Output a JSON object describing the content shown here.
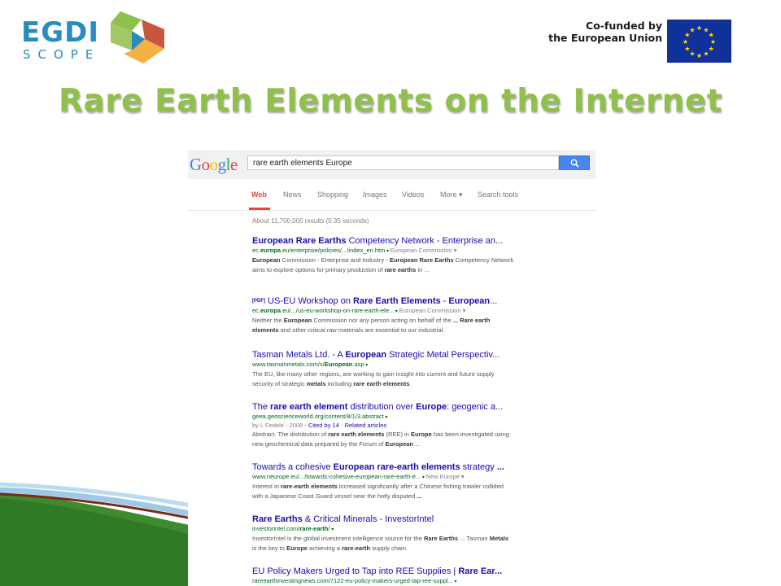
{
  "logo": {
    "name": "EGDI",
    "sub": "SCOPE"
  },
  "eu": {
    "line1": "Co-funded by",
    "line2": "the European Union"
  },
  "slide_title": "Rare Earth Elements on the Internet",
  "google": {
    "logo": "Google",
    "query": "rare earth elements Europe",
    "tabs": [
      "Web",
      "News",
      "Shopping",
      "Images",
      "Videos",
      "More ▾",
      "Search tools"
    ],
    "stats": "About 11,700,000 results (0.35 seconds)",
    "results": [
      {
        "title_parts": [
          [
            "European Rare Earths",
            1
          ],
          [
            " Competency Network - Enterprise an...",
            0
          ]
        ],
        "url_parts": [
          [
            "ec.",
            0
          ],
          [
            "europa",
            1
          ],
          [
            ".eu/enterprise/policies/.../index_en.htm",
            0
          ]
        ],
        "source": "European Commission",
        "desc_parts": [
          [
            "European",
            1
          ],
          [
            " Commission - Enterprise and Industry - ",
            0
          ],
          [
            "European Rare Earths",
            1
          ],
          [
            " Competency Network aims to explore options for primary production of ",
            0
          ],
          [
            "rare earths",
            1
          ],
          [
            " in ...",
            0
          ]
        ]
      },
      {
        "pdf": "[PDF]",
        "title_parts": [
          [
            " US-EU Workshop on ",
            0
          ],
          [
            "Rare Earth Elements",
            1
          ],
          [
            " - ",
            0
          ],
          [
            "European",
            1
          ],
          [
            "...",
            0
          ]
        ],
        "url_parts": [
          [
            "ec.",
            0
          ],
          [
            "europa",
            1
          ],
          [
            ".eu/.../us-eu-workshop-on-rare-earth-ele...",
            0
          ]
        ],
        "source": "European Commission",
        "desc_parts": [
          [
            "Neither the ",
            0
          ],
          [
            "European",
            1
          ],
          [
            " Commission nor any person acting on behalf of the ",
            0
          ],
          [
            "...",
            1
          ],
          [
            " ",
            0
          ],
          [
            "Rare earth elements",
            1
          ],
          [
            " and other critical raw materials are essential to our industrial.",
            0
          ]
        ]
      },
      {
        "title_parts": [
          [
            "Tasman Metals Ltd. - A ",
            0
          ],
          [
            "European",
            1
          ],
          [
            " Strategic Metal Perspectiv...",
            0
          ]
        ],
        "url_parts": [
          [
            "www.tasmanmetals.com/s/",
            0
          ],
          [
            "European",
            1
          ],
          [
            ".asp",
            0
          ]
        ],
        "desc_parts": [
          [
            "The EU, like many other regions, are working to gain insight into current and future supply security of strategic ",
            0
          ],
          [
            "metals",
            1
          ],
          [
            " including ",
            0
          ],
          [
            "rare earth elements",
            1
          ],
          [
            ".",
            0
          ]
        ]
      },
      {
        "title_parts": [
          [
            "The ",
            0
          ],
          [
            "rare earth element",
            1
          ],
          [
            " distribution over ",
            0
          ],
          [
            "Europe",
            1
          ],
          [
            ": geogenic a...",
            0
          ]
        ],
        "url_parts": [
          [
            "geea.geoscienceworld.org/content/8/1/3.abstract",
            0
          ]
        ],
        "meta": {
          "author": "by L Fedele - 2008 - ",
          "cited": "Cited by 14",
          "sep": " - ",
          "related": "Related articles"
        },
        "desc_parts": [
          [
            "Abstract. The distribution of ",
            0
          ],
          [
            "rare earth elements",
            1
          ],
          [
            " (REE) in ",
            0
          ],
          [
            "Europe",
            1
          ],
          [
            " has been investigated using new geochemical data prepared by the Forum of ",
            0
          ],
          [
            "European",
            1
          ],
          [
            " ...",
            0
          ]
        ]
      },
      {
        "title_parts": [
          [
            "Towards a cohesive ",
            0
          ],
          [
            "European rare-earth elements",
            1
          ],
          [
            " strategy ",
            0
          ],
          [
            "...",
            1
          ]
        ],
        "url_parts": [
          [
            "www.neurope.eu/.../towards-cohesive-european-rare-earth-e...",
            0
          ]
        ],
        "source": "New Europe",
        "desc_parts": [
          [
            "Interest in ",
            0
          ],
          [
            "rare-earth elements",
            1
          ],
          [
            " increased significantly after a Chinese fishing trawler collided with a Japanese Coast Guard vessel near the hotly disputed ",
            0
          ],
          [
            "...",
            1
          ]
        ]
      },
      {
        "title_parts": [
          [
            "Rare Earths",
            1
          ],
          [
            " & Critical Minerals - InvestorIntel",
            0
          ]
        ],
        "url_parts": [
          [
            "investorintel.com/",
            0
          ],
          [
            "rare-earth",
            1
          ],
          [
            "/",
            0
          ]
        ],
        "desc_parts": [
          [
            "InvestorIntel is the global investment intelligence source for the ",
            0
          ],
          [
            "Rare Earths",
            1
          ],
          [
            " ... Tasman ",
            0
          ],
          [
            "Metals",
            1
          ],
          [
            " is the key to ",
            0
          ],
          [
            "Europe",
            1
          ],
          [
            " achieving a ",
            0
          ],
          [
            "rare-earth",
            1
          ],
          [
            " supply chain.",
            0
          ]
        ]
      },
      {
        "title_parts": [
          [
            "EU Policy Makers Urged to Tap into REE Supplies | ",
            0
          ],
          [
            "Rare Ear...",
            1
          ]
        ],
        "url_parts": [
          [
            "rareearthinvestingnews.com/7122-eu-policy-makers-urged-tap-ree-suppl...",
            0
          ]
        ]
      }
    ]
  },
  "colors": {
    "title_green": "#8fc04b",
    "link_blue": "#1a0dab",
    "url_green": "#006621",
    "google_red": "#dd4b39",
    "eu_blue": "#10309a",
    "egdi_blue": "#2a8bbf"
  }
}
